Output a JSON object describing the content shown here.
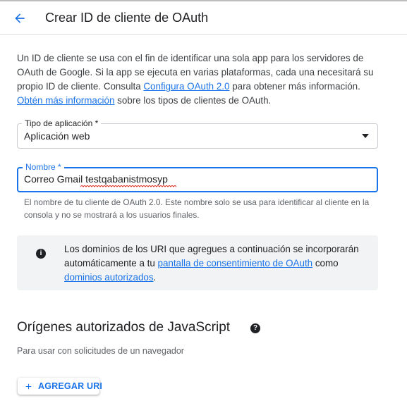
{
  "header": {
    "back_icon": "arrow-back-icon",
    "title": "Crear ID de cliente de OAuth"
  },
  "intro": {
    "text_1": "Un ID de cliente se usa con el fin de identificar una sola app para los servidores de OAuth de Google. Si la app se ejecuta en varias plataformas, cada una necesitará su propio ID de cliente. Consulta ",
    "link_1": "Configura OAuth 2.0",
    "text_2": " para obtener más información. ",
    "link_2": "Obtén más información",
    "text_3": " sobre los tipos de clientes de OAuth."
  },
  "app_type": {
    "label": "Tipo de aplicación *",
    "value": "Aplicación web",
    "icon": "dropdown-arrow-icon"
  },
  "name_field": {
    "label": "Nombre *",
    "value": "Correo Gmail testqabanistmosyp",
    "hint": "El nombre de tu cliente de OAuth 2.0. Este nombre solo se usa para identificar al cliente en la consola y no se mostrará a los usuarios finales."
  },
  "info_box": {
    "icon": "info-icon",
    "text_1": "Los dominios de los URI que agregues a continuación se incorporarán automáticamente a tu ",
    "link_1": "pantalla de consentimiento de OAuth",
    "text_2": " como ",
    "link_2": "dominios autorizados",
    "text_3": "."
  },
  "js_origins": {
    "title": "Orígenes autorizados de JavaScript",
    "help_icon": "help-icon",
    "subtitle": "Para usar con solicitudes de un navegador",
    "add_button": "AGREGAR URI",
    "add_icon": "plus-icon"
  },
  "colors": {
    "accent": "#1a73e8",
    "text": "#202124",
    "secondary_text": "#5f6368",
    "info_bg": "#f1f3f4",
    "spellcheck": "#d93025"
  }
}
